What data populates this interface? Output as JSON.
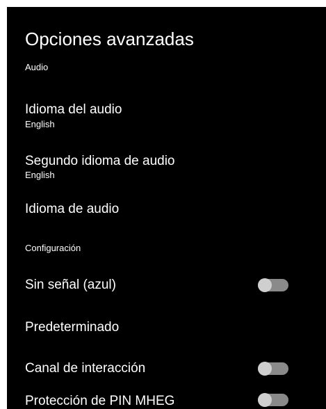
{
  "screen": {
    "title": "Opciones avanzadas"
  },
  "sections": {
    "audio": "Audio",
    "configuracion": "Configuración"
  },
  "items": {
    "idioma_audio": {
      "label": "Idioma del audio",
      "value": "English"
    },
    "segundo_idioma": {
      "label": "Segundo idioma de audio",
      "value": "English"
    },
    "idioma_de_audio": {
      "label": "Idioma de audio"
    },
    "sin_senal": {
      "label": "Sin señal (azul)",
      "toggle": "off"
    },
    "predeterminado": {
      "label": "Predeterminado"
    },
    "canal_interaccion": {
      "label": "Canal de interacción",
      "toggle": "off"
    },
    "proteccion_pin": {
      "label": "Protección de PIN MHEG",
      "toggle": "off"
    }
  },
  "colors": {
    "background": "#000000",
    "text": "#ffffff",
    "toggle_track": "#8a8a8a",
    "toggle_knob": "#cfcfcf"
  }
}
